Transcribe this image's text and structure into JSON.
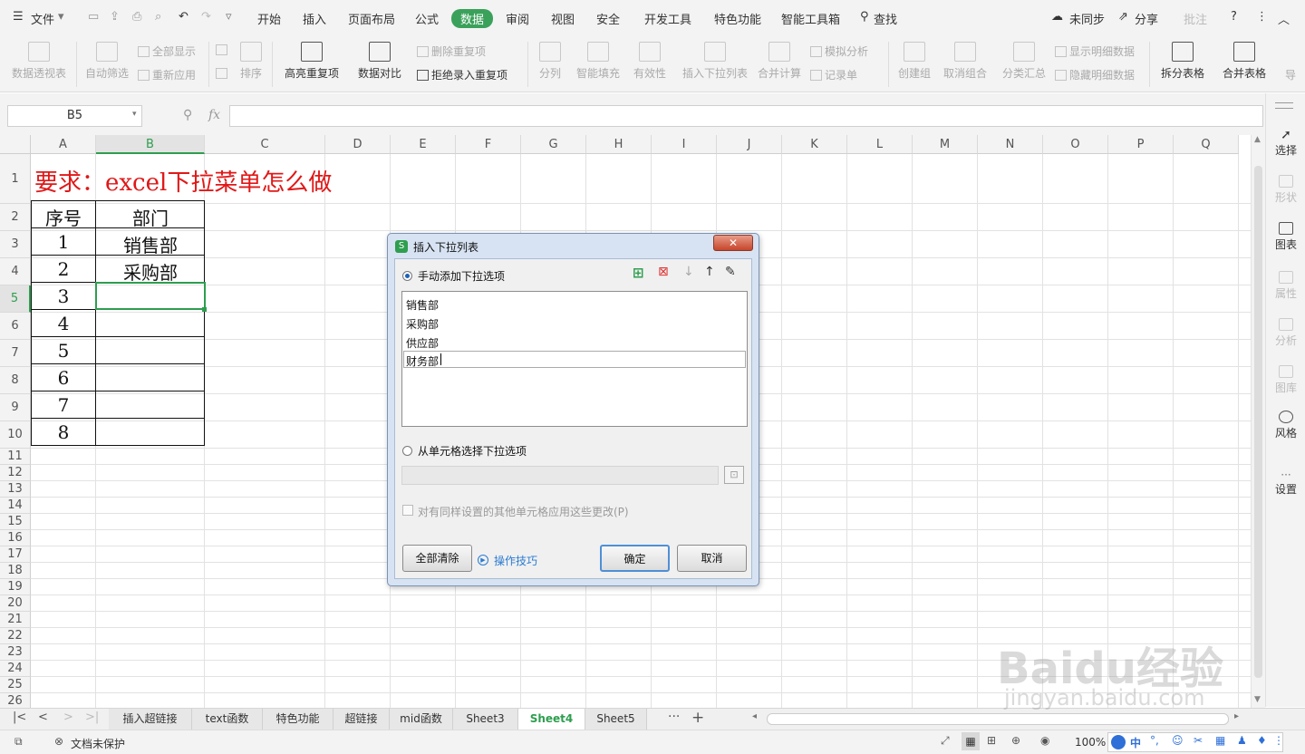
{
  "menu": {
    "file": "文件",
    "items": [
      "开始",
      "插入",
      "页面布局",
      "公式",
      "数据",
      "审阅",
      "视图",
      "安全",
      "开发工具",
      "特色功能",
      "智能工具箱"
    ],
    "search": "查找",
    "sync": "未同步",
    "share": "分享",
    "comment": "批注"
  },
  "ribbon": {
    "pivot": "数据透视表",
    "autofilter": "自动筛选",
    "show_all": "全部显示",
    "reapply": "重新应用",
    "sort": "排序",
    "highlight_dup": "高亮重复项",
    "compare": "数据对比",
    "remove_dup": "删除重复项",
    "reject_dup": "拒绝录入重复项",
    "split": "分列",
    "smart_fill": "智能填充",
    "validity": "有效性",
    "insert_dropdown": "插入下拉列表",
    "merge_calc": "合并计算",
    "simulate": "模拟分析",
    "record": "记录单",
    "create_group": "创建组",
    "ungroup": "取消组合",
    "subtotal": "分类汇总",
    "show_detail": "显示明细数据",
    "hide_detail": "隐藏明细数据",
    "split_table": "拆分表格",
    "merge_table": "合并表格",
    "more": "导"
  },
  "formula": {
    "cell_ref": "B5",
    "fx": "fx"
  },
  "columns": [
    "A",
    "B",
    "C",
    "D",
    "E",
    "F",
    "G",
    "H",
    "I",
    "J",
    "K",
    "L",
    "M",
    "N",
    "O",
    "P",
    "Q"
  ],
  "rows": [
    "1",
    "2",
    "3",
    "4",
    "5",
    "6",
    "7",
    "8",
    "9",
    "10",
    "11",
    "12",
    "13",
    "14",
    "15",
    "16",
    "17",
    "18",
    "19",
    "20",
    "21",
    "22",
    "23",
    "24",
    "25",
    "26"
  ],
  "sheet": {
    "title": "要求：excel下拉菜单怎么做",
    "h_seq": "序号",
    "h_dept": "部门",
    "seq": [
      "1",
      "2",
      "3",
      "4",
      "5",
      "6",
      "7",
      "8"
    ],
    "dept": [
      "销售部",
      "采购部"
    ]
  },
  "right_panel": [
    "选择",
    "形状",
    "图表",
    "属性",
    "分析",
    "图库",
    "风格",
    "设置"
  ],
  "tabs": [
    "插入超链接",
    "text函数",
    "特色功能",
    "超链接",
    "mid函数",
    "Sheet3",
    "Sheet4",
    "Sheet5"
  ],
  "status": {
    "protect": "文档未保护",
    "zoom": "100%",
    "ime": "中"
  },
  "dialog": {
    "title": "插入下拉列表",
    "manual": "手动添加下拉选项",
    "options": [
      "销售部",
      "采购部",
      "供应部",
      "财务部"
    ],
    "from_cells": "从单元格选择下拉选项",
    "apply_same": "对有同样设置的其他单元格应用这些更改(P)",
    "clear_all": "全部清除",
    "tips": "操作技巧",
    "ok": "确定",
    "cancel": "取消"
  },
  "watermark": {
    "brand": "Baidu经验",
    "url": "jingyan.baidu.com"
  },
  "colors": {
    "accent_green": "#3aa15a",
    "title_red": "#e01818",
    "selection": "#2e9e4f"
  }
}
